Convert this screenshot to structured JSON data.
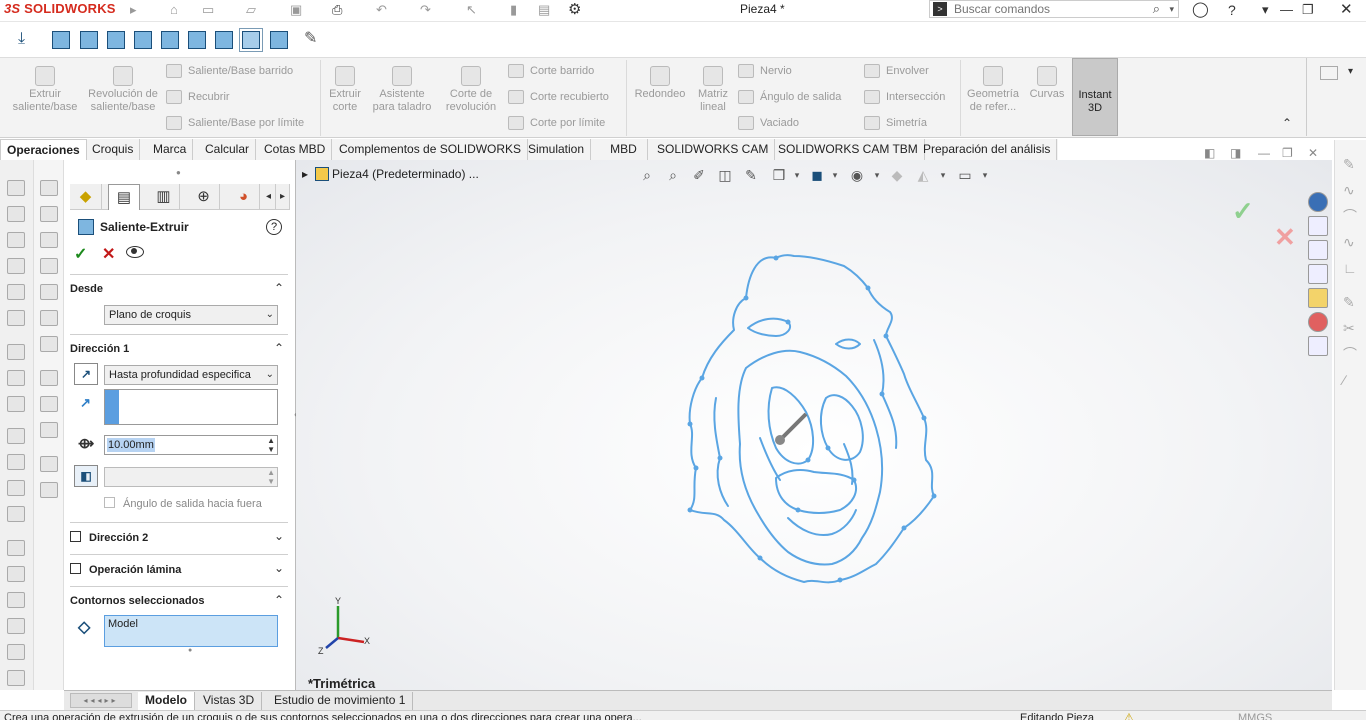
{
  "app": {
    "logo_prefix": "3S",
    "logo_name": "SOLIDWORKS",
    "doc_title": "Pieza4 *"
  },
  "search": {
    "placeholder": "Buscar comandos"
  },
  "ribbon": {
    "extruir_saliente": "Extruir saliente/base",
    "revolucion": "Revolución de saliente/base",
    "saliente_barrido": "Saliente/Base barrido",
    "recubrir": "Recubrir",
    "saliente_limite": "Saliente/Base por límite",
    "extruir_corte": "Extruir corte",
    "asistente_taladro": "Asistente para taladro",
    "corte_revolucion": "Corte de revolución",
    "corte_barrido": "Corte barrido",
    "corte_recubierto": "Corte recubierto",
    "corte_limite": "Corte por límite",
    "redondeo": "Redondeo",
    "matriz_lineal": "Matriz lineal",
    "nervio": "Nervio",
    "angulo_salida": "Ángulo de salida",
    "vaciado": "Vaciado",
    "envolver": "Envolver",
    "interseccion": "Intersección",
    "simetria": "Simetría",
    "geometria_ref": "Geometría de refer...",
    "curvas": "Curvas",
    "instant3d": "Instant 3D"
  },
  "tabs": [
    "Operaciones",
    "Croquis",
    "Marca",
    "Calcular",
    "Cotas MBD",
    "Complementos de SOLIDWORKS",
    "Simulation",
    "MBD",
    "SOLIDWORKS CAM",
    "SOLIDWORKS CAM TBM",
    "Preparación del análisis"
  ],
  "pm": {
    "title": "Saliente-Extruir",
    "desde_label": "Desde",
    "desde_value": "Plano de croquis",
    "dir1_label": "Dirección 1",
    "dir1_type": "Hasta profundidad especifica",
    "depth": "10.00mm",
    "draft_outward": "Ángulo de salida hacia fuera",
    "dir2_label": "Dirección 2",
    "thin_label": "Operación lámina",
    "contours_label": "Contornos seleccionados",
    "contours_value": "Model"
  },
  "graphics": {
    "breadcrumb": "Pieza4 (Predeterminado) ...",
    "view_name": "*Trimétrica",
    "triad": {
      "x": "X",
      "y": "Y",
      "z": "Z"
    }
  },
  "bottom_tabs": [
    "Modelo",
    "Vistas 3D",
    "Estudio de movimiento 1"
  ],
  "status": {
    "message": "Crea una operación de extrusión de un croquis o de sus contornos seleccionados en una o dos direcciones para crear una opera...",
    "mode": "Editando Pieza",
    "units": "MMGS"
  },
  "colors": {
    "sketch": "#5aa5e3",
    "accept": "#1d8a1d",
    "cancel": "#c21818",
    "brand": "#d52b1e"
  }
}
